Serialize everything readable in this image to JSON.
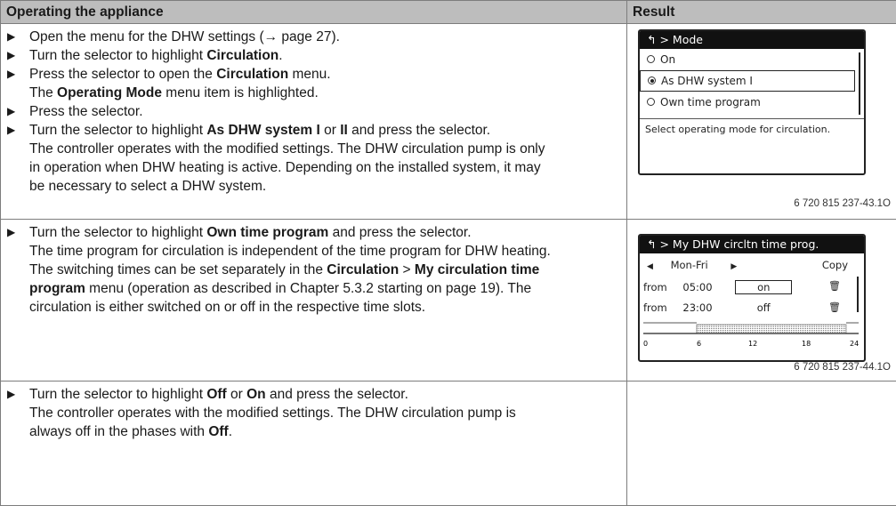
{
  "table": {
    "col_operating": "Operating the appliance",
    "col_result": "Result"
  },
  "row1": {
    "steps": [
      {
        "type": "bullet",
        "parts": [
          {
            "t": "Open the menu for the DHW settings (→ page 27)."
          }
        ]
      },
      {
        "type": "bullet",
        "parts": [
          {
            "t": "Turn the selector to highlight "
          },
          {
            "t": "Circulation",
            "b": true
          },
          {
            "t": "."
          }
        ]
      },
      {
        "type": "bullet",
        "parts": [
          {
            "t": "Press the selector to open the "
          },
          {
            "t": "Circulation",
            "b": true
          },
          {
            "t": " menu."
          }
        ]
      },
      {
        "type": "cont",
        "parts": [
          {
            "t": "The "
          },
          {
            "t": "Operating Mode",
            "b": true
          },
          {
            "t": " menu item is highlighted."
          }
        ]
      },
      {
        "type": "bullet",
        "parts": [
          {
            "t": "Press the selector."
          }
        ]
      },
      {
        "type": "bullet",
        "parts": [
          {
            "t": "Turn the selector to highlight "
          },
          {
            "t": "As DHW system I",
            "b": true
          },
          {
            "t": " or "
          },
          {
            "t": "II",
            "b": true
          },
          {
            "t": " and press the selector."
          }
        ]
      },
      {
        "type": "cont",
        "parts": [
          {
            "t": "The controller operates with the modified settings. The DHW circulation pump is only"
          }
        ]
      },
      {
        "type": "cont",
        "parts": [
          {
            "t": "in operation when DHW heating is active. Depending on the installed system, it may"
          }
        ]
      },
      {
        "type": "cont",
        "parts": [
          {
            "t": "be necessary to select a DHW system."
          }
        ]
      }
    ],
    "screen": {
      "title": "> Mode",
      "options": [
        {
          "label": "On",
          "selected": false
        },
        {
          "label": "As DHW system I",
          "selected": true
        },
        {
          "label": "Own time program",
          "selected": false
        }
      ],
      "hint": "Select operating mode for circulation.",
      "caption": "6 720 815 237-43.1O"
    }
  },
  "row2": {
    "steps": [
      {
        "type": "bullet",
        "parts": [
          {
            "t": "Turn the selector to highlight "
          },
          {
            "t": "Own time program",
            "b": true
          },
          {
            "t": " and press the selector."
          }
        ]
      },
      {
        "type": "cont",
        "parts": [
          {
            "t": "The time program for circulation is independent of the time program for DHW heating."
          }
        ]
      },
      {
        "type": "cont",
        "parts": [
          {
            "t": "The switching times can be set separately in the "
          },
          {
            "t": "Circulation",
            "b": true
          },
          {
            "t": " > "
          },
          {
            "t": "My circulation time",
            "b": true
          }
        ]
      },
      {
        "type": "cont",
        "parts": [
          {
            "t": "program",
            "b": true
          },
          {
            "t": " menu (operation as described in Chapter 5.3.2 starting on page 19). The"
          }
        ]
      },
      {
        "type": "cont",
        "parts": [
          {
            "t": "circulation is either switched on or off in the respective time slots."
          }
        ]
      }
    ],
    "screen": {
      "title": "> My DHW circltn time prog.",
      "day": "Mon-Fri",
      "copy": "Copy",
      "rows": [
        {
          "from": "from",
          "time": "05:00",
          "state": "on"
        },
        {
          "from": "from",
          "time": "23:00",
          "state": "off"
        }
      ],
      "axis_ticks": [
        "0",
        "6",
        "12",
        "18",
        "24"
      ],
      "caption": "6 720 815 237-44.1O"
    }
  },
  "row3": {
    "steps": [
      {
        "type": "bullet",
        "parts": [
          {
            "t": "Turn the selector to highlight "
          },
          {
            "t": "Off",
            "b": true
          },
          {
            "t": " or "
          },
          {
            "t": "On",
            "b": true
          },
          {
            "t": " and press the selector."
          }
        ]
      },
      {
        "type": "cont",
        "parts": [
          {
            "t": "The controller operates with the modified settings. The DHW circulation pump is"
          }
        ]
      },
      {
        "type": "cont",
        "parts": [
          {
            "t": "always off in the phases with "
          },
          {
            "t": "Off",
            "b": true
          },
          {
            "t": "."
          }
        ]
      }
    ]
  }
}
